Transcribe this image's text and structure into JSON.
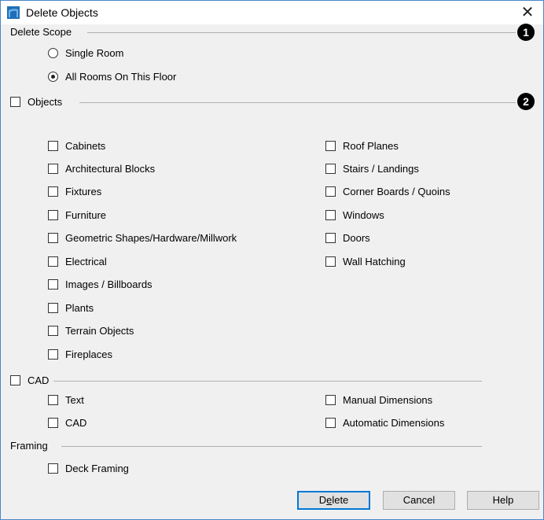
{
  "window": {
    "title": "Delete Objects",
    "close_glyph": "✕"
  },
  "delete_scope": {
    "label": "Delete Scope",
    "callout": "1",
    "options": [
      {
        "label": "Single Room",
        "selected": false
      },
      {
        "label": "All Rooms On This Floor",
        "selected": true
      }
    ]
  },
  "objects": {
    "label": "Objects",
    "callout": "2",
    "left": [
      "Cabinets",
      "Architectural Blocks",
      "Fixtures",
      "Furniture",
      "Geometric Shapes/Hardware/Millwork",
      "Electrical",
      "Images / Billboards",
      "Plants",
      "Terrain Objects",
      "Fireplaces"
    ],
    "right": [
      "Roof Planes",
      "Stairs / Landings",
      "Corner Boards / Quoins",
      "Windows",
      "Doors",
      "Wall Hatching"
    ]
  },
  "cad": {
    "label": "CAD",
    "left": [
      "Text",
      "CAD"
    ],
    "right": [
      "Manual Dimensions",
      "Automatic Dimensions"
    ]
  },
  "framing": {
    "label": "Framing",
    "items": [
      "Deck Framing"
    ]
  },
  "buttons": {
    "delete_prefix": "D",
    "delete_mnemonic": "e",
    "delete_suffix": "lete",
    "cancel": "Cancel",
    "help": "Help"
  },
  "colors": {
    "accent": "#0078d7",
    "icon_blue": "#1e6fb8"
  }
}
